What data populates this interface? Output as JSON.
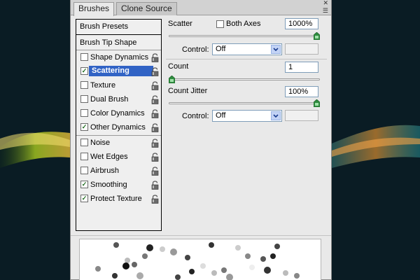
{
  "tabs": [
    {
      "label": "Brushes",
      "active": true
    },
    {
      "label": "Clone Source",
      "active": false
    }
  ],
  "window_controls": {
    "close_glyph": "✕",
    "menu_glyph": "☰"
  },
  "brush_list": {
    "presets": "Brush Presets",
    "tip_shape": "Brush Tip Shape",
    "items": [
      {
        "label": "Shape Dynamics",
        "checked": false,
        "selected": false
      },
      {
        "label": "Scattering",
        "checked": true,
        "selected": true
      },
      {
        "label": "Texture",
        "checked": false,
        "selected": false
      },
      {
        "label": "Dual Brush",
        "checked": false,
        "selected": false
      },
      {
        "label": "Color Dynamics",
        "checked": false,
        "selected": false
      },
      {
        "label": "Other Dynamics",
        "checked": true,
        "selected": false
      }
    ],
    "extras": [
      {
        "label": "Noise",
        "checked": false
      },
      {
        "label": "Wet Edges",
        "checked": false
      },
      {
        "label": "Airbrush",
        "checked": false
      },
      {
        "label": "Smoothing",
        "checked": true
      },
      {
        "label": "Protect Texture",
        "checked": true
      }
    ],
    "check_glyph": "✓"
  },
  "scatter": {
    "label": "Scatter",
    "both_axes_label": "Both Axes",
    "both_axes_checked": false,
    "value": "1000%",
    "slider_fraction": 1.0,
    "control_label": "Control:",
    "control_value": "Off"
  },
  "count": {
    "label": "Count",
    "value": "1",
    "slider_fraction": 0.0
  },
  "count_jitter": {
    "label": "Count Jitter",
    "value": "100%",
    "slider_fraction": 1.0,
    "control_label": "Control:",
    "control_value": "Off"
  },
  "colors": {
    "selection": "#3163c5",
    "check": "#1d6b1d",
    "thumb": "#2e8b3e"
  }
}
